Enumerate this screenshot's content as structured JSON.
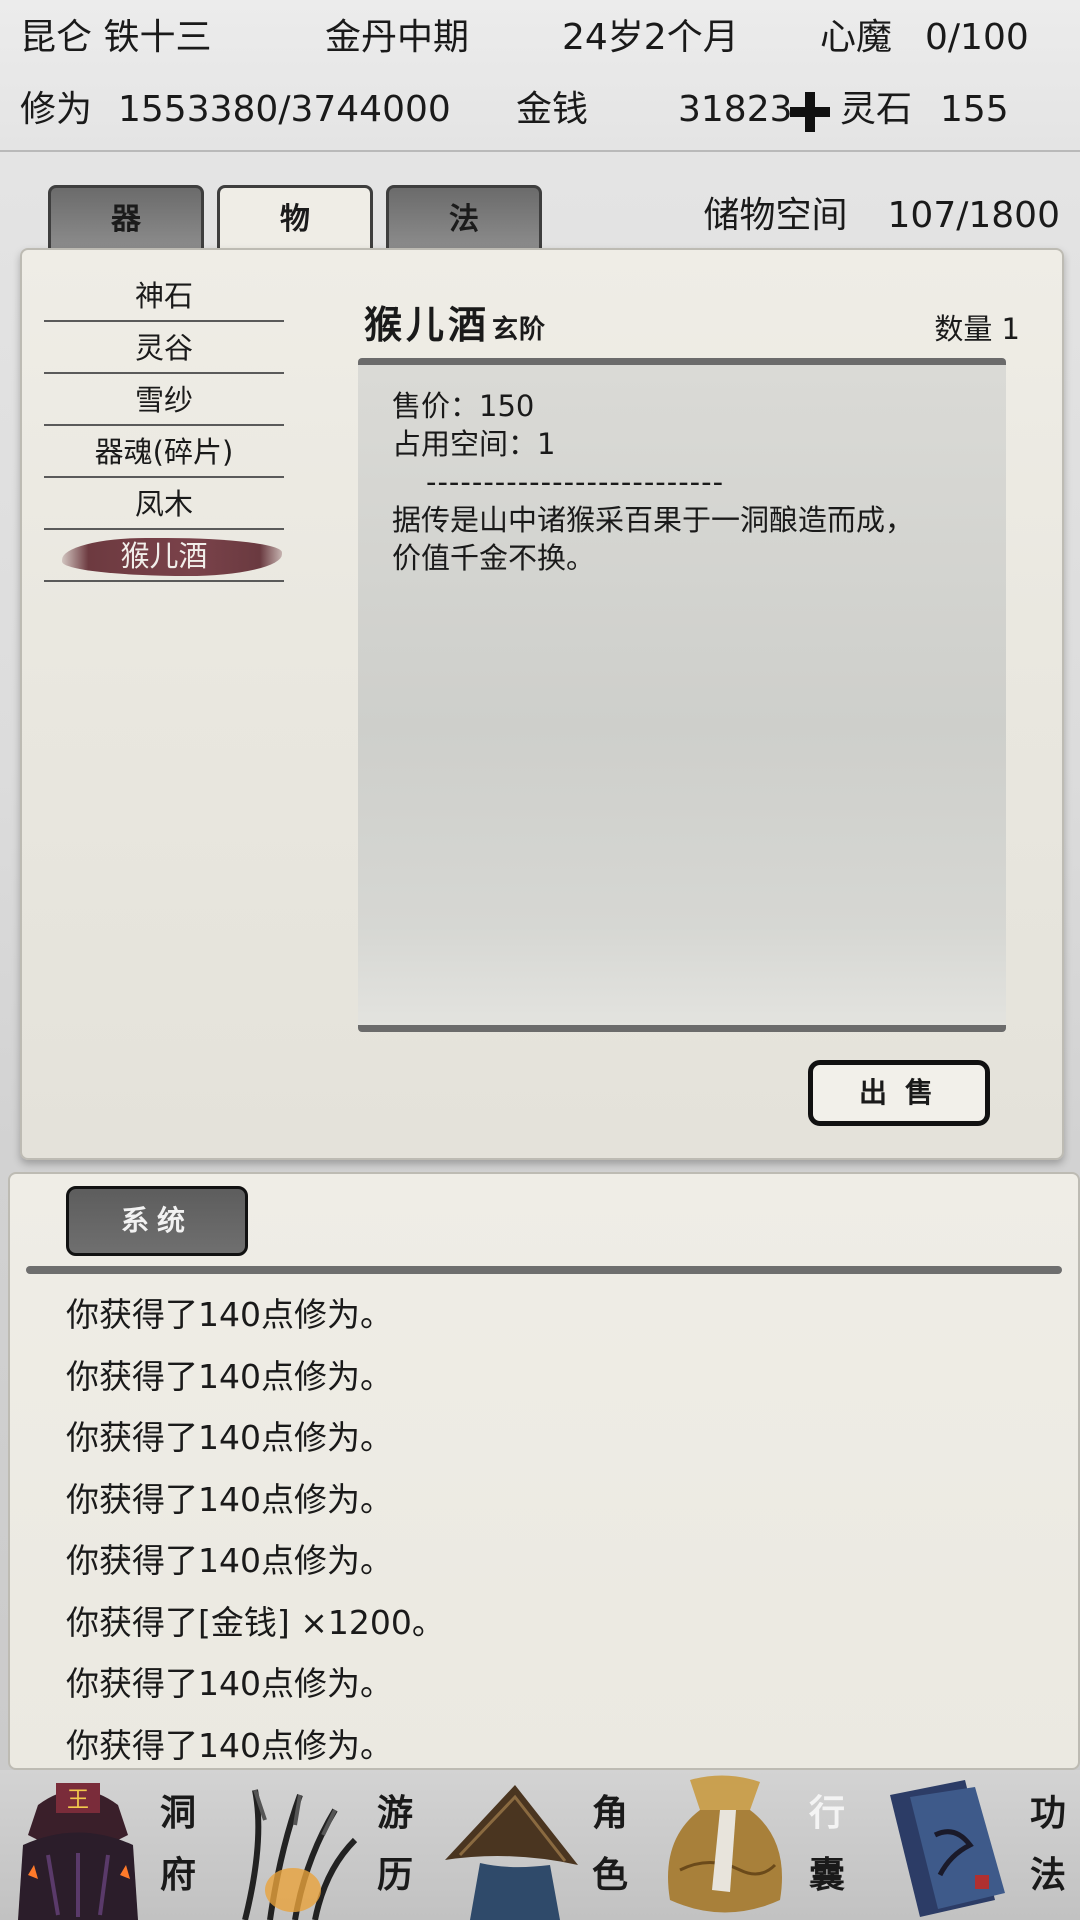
{
  "status": {
    "name": "昆仑 铁十三",
    "realm": "金丹中期",
    "age": "24岁2个月",
    "heart_demon_label": "心魔",
    "heart_demon_value": "0/100",
    "cultivation_label": "修为",
    "cultivation_value": "1553380/3744000",
    "money_label": "金钱",
    "money_value": "31823",
    "spirit_stone_label": "灵石",
    "spirit_stone_value": "155"
  },
  "tabs": [
    {
      "label": "器",
      "active": false
    },
    {
      "label": "物",
      "active": true
    },
    {
      "label": "法",
      "active": false
    }
  ],
  "storage": {
    "label": "储物空间",
    "value": "107/1800"
  },
  "items": [
    {
      "label": "神石"
    },
    {
      "label": "灵谷"
    },
    {
      "label": "雪纱"
    },
    {
      "label": "器魂(碎片)"
    },
    {
      "label": "凤木"
    },
    {
      "label": "猴儿酒",
      "selected": true
    }
  ],
  "detail": {
    "name": "猴儿酒",
    "grade": "玄阶",
    "quantity": "数量 1",
    "price": "售价：150",
    "space": "占用空间：1",
    "separator": "--------------------------",
    "desc_line1": "据传是山中诸猴采百果于一洞酿造而成，",
    "desc_line2": "价值千金不换。",
    "sell_label": "出售"
  },
  "log": {
    "tab_label": "系统",
    "lines": [
      "你获得了140点修为。",
      "你获得了140点修为。",
      "你获得了140点修为。",
      "你获得了140点修为。",
      "你获得了140点修为。",
      "你获得了[金钱] ×1200。",
      "你获得了140点修为。",
      "你获得了140点修为。"
    ]
  },
  "nav": [
    {
      "top": "洞",
      "bottom": "府",
      "icon": "cave-abode-icon"
    },
    {
      "top": "游",
      "bottom": "历",
      "icon": "travel-icon"
    },
    {
      "top": "角",
      "bottom": "色",
      "icon": "character-icon"
    },
    {
      "top": "行",
      "bottom": "囊",
      "icon": "bag-icon"
    },
    {
      "top": "功",
      "bottom": "法",
      "icon": "scripture-icon"
    }
  ],
  "colors": {
    "selected_item_bg": "#7a424a",
    "tab_inactive": "#7a7a7a",
    "panel_bg": "#efede6"
  }
}
